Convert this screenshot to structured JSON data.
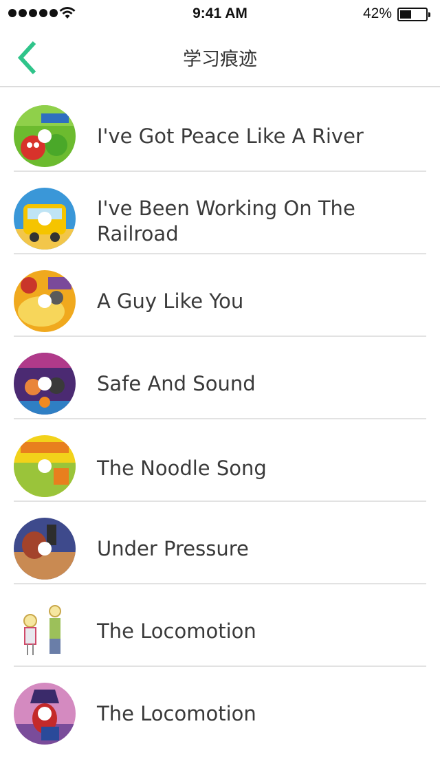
{
  "status_bar": {
    "time": "9:41 AM",
    "battery_percent": "42%",
    "signal_icon": "signal-bars-icon",
    "wifi_icon": "wifi-icon",
    "battery_icon": "battery-icon",
    "battery_level": 0.42
  },
  "nav": {
    "back_icon": "chevron-left-icon",
    "title": "学习痕迹",
    "accent_color": "#2fc48a"
  },
  "songs": [
    {
      "title": "I've Got Peace Like A River",
      "cover_icon": "veggietales-disc-icon"
    },
    {
      "title": "I've Been Working On The Railroad",
      "cover_icon": "yellow-bus-disc-icon"
    },
    {
      "title": "A Guy Like You",
      "cover_icon": "mother-goose-disc-icon"
    },
    {
      "title": "Safe And Sound",
      "cover_icon": "halloween-disc-icon"
    },
    {
      "title": "The Noodle Song",
      "cover_icon": "spookley-pumpkin-disc-icon"
    },
    {
      "title": "Under Pressure",
      "cover_icon": "turkey-disc-icon"
    },
    {
      "title": "The Locomotion",
      "cover_icon": "charlie-and-lola-icon"
    },
    {
      "title": "The Locomotion",
      "cover_icon": "pirate-bird-disc-icon"
    }
  ]
}
